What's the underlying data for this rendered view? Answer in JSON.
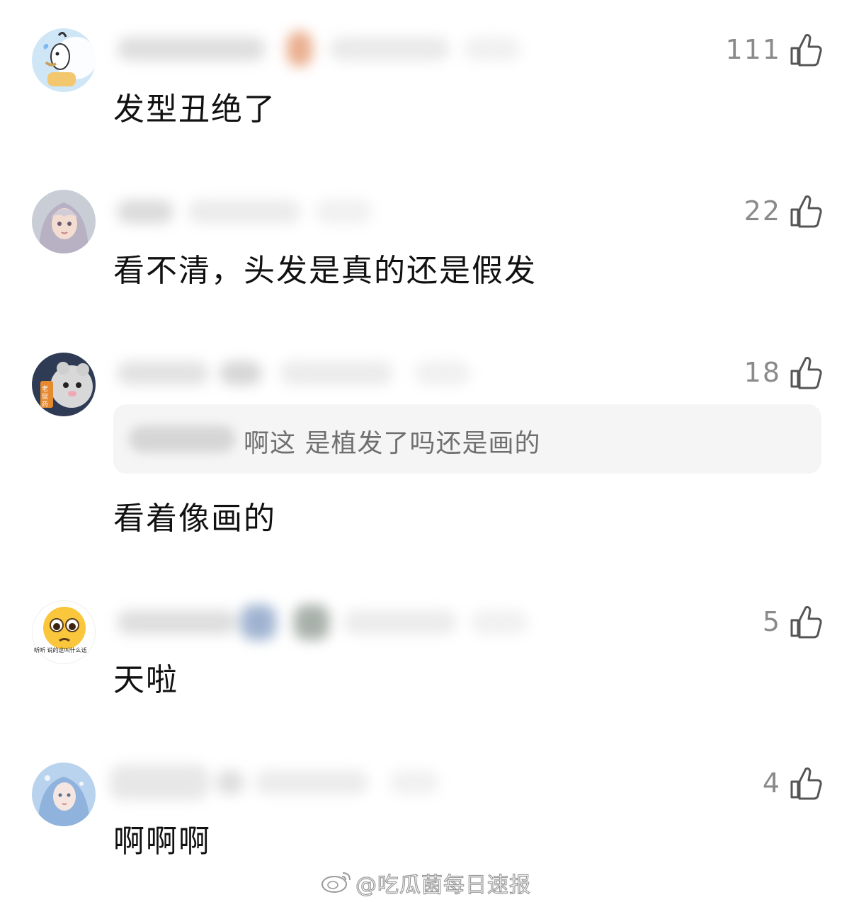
{
  "comments": [
    {
      "likes": "111",
      "text": "发型丑绝了"
    },
    {
      "likes": "22",
      "text": "看不清，头发是真的还是假发"
    },
    {
      "likes": "18",
      "reply_text": "啊这 是植发了吗还是画的",
      "text": "看着像画的"
    },
    {
      "likes": "5",
      "text": "天啦",
      "avatar_caption": "听听 说的这叫什么话"
    },
    {
      "likes": "4",
      "text": "啊啊啊"
    }
  ],
  "watermark": {
    "text": "@吃瓜菌每日速报"
  },
  "colors": {
    "like_count": "#8a8a8a",
    "quote_bg": "#f5f5f5",
    "text": "#111111"
  },
  "icons": {
    "like": "thumbs-up-icon",
    "watermark": "weibo-logo-icon"
  }
}
